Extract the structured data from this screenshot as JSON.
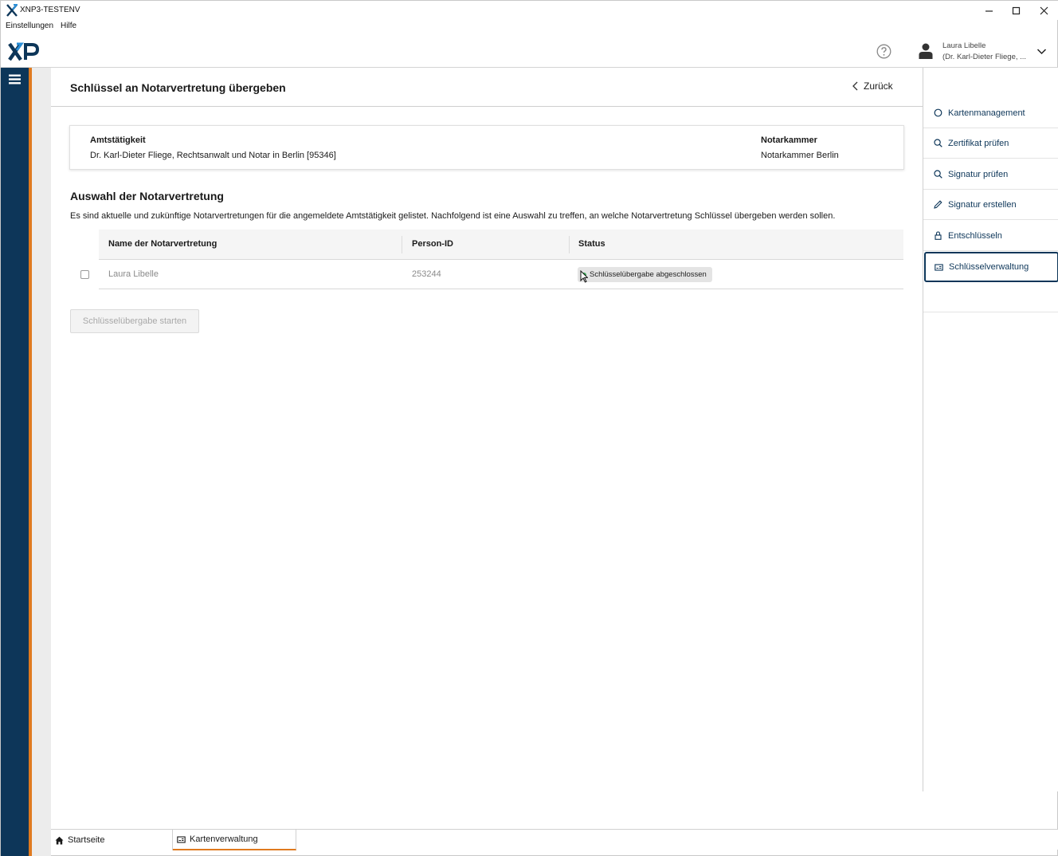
{
  "window": {
    "title": "XNP3-TESTENV"
  },
  "menu": {
    "items": [
      "Einstellungen",
      "Hilfe"
    ]
  },
  "header": {
    "logo_text": "XNP",
    "user_name": "Laura Libelle",
    "user_sub": "(Dr. Karl-Dieter Fliege, ..."
  },
  "page": {
    "title": "Schlüssel an Notarvertretung übergeben",
    "back_label": "Zurück"
  },
  "info": {
    "amt_label": "Amtstätigkeit",
    "amt_value": "Dr. Karl-Dieter Fliege, Rechtsanwalt und Notar in Berlin [95346]",
    "kammer_label": "Notarkammer",
    "kammer_value": "Notarkammer Berlin"
  },
  "selection": {
    "title": "Auswahl der Notarvertretung",
    "description": "Es sind aktuelle und zukünftige Notarvertretungen für die angemeldete Amtstätigkeit gelistet. Nachfolgend ist eine Auswahl zu treffen, an welche Notarvertretung Schlüssel übergeben werden sollen.",
    "columns": [
      "Name der Notarvertretung",
      "Person-ID",
      "Status"
    ],
    "rows": [
      {
        "name": "Laura Libelle",
        "person_id": "253244",
        "status": "Schlüsselübergabe abgeschlossen"
      }
    ],
    "start_button": "Schlüsselübergabe starten"
  },
  "right_panel": {
    "items": [
      {
        "label": "Kartenmanagement",
        "icon": "card-icon"
      },
      {
        "label": "Zertifikat prüfen",
        "icon": "search-icon"
      },
      {
        "label": "Signatur prüfen",
        "icon": "search-icon"
      },
      {
        "label": "Signatur erstellen",
        "icon": "pen-icon"
      },
      {
        "label": "Entschlüsseln",
        "icon": "lock-icon"
      },
      {
        "label": "Schlüsselverwaltung",
        "icon": "key-management-icon"
      }
    ],
    "active_index": 5
  },
  "tabs": [
    {
      "label": "Startseite",
      "icon": "home-icon"
    },
    {
      "label": "Kartenverwaltung",
      "icon": "key-management-icon"
    }
  ],
  "colors": {
    "sidebar": "#0d3659",
    "accent": "#e07a1f",
    "status_ok": "#3aa856"
  }
}
